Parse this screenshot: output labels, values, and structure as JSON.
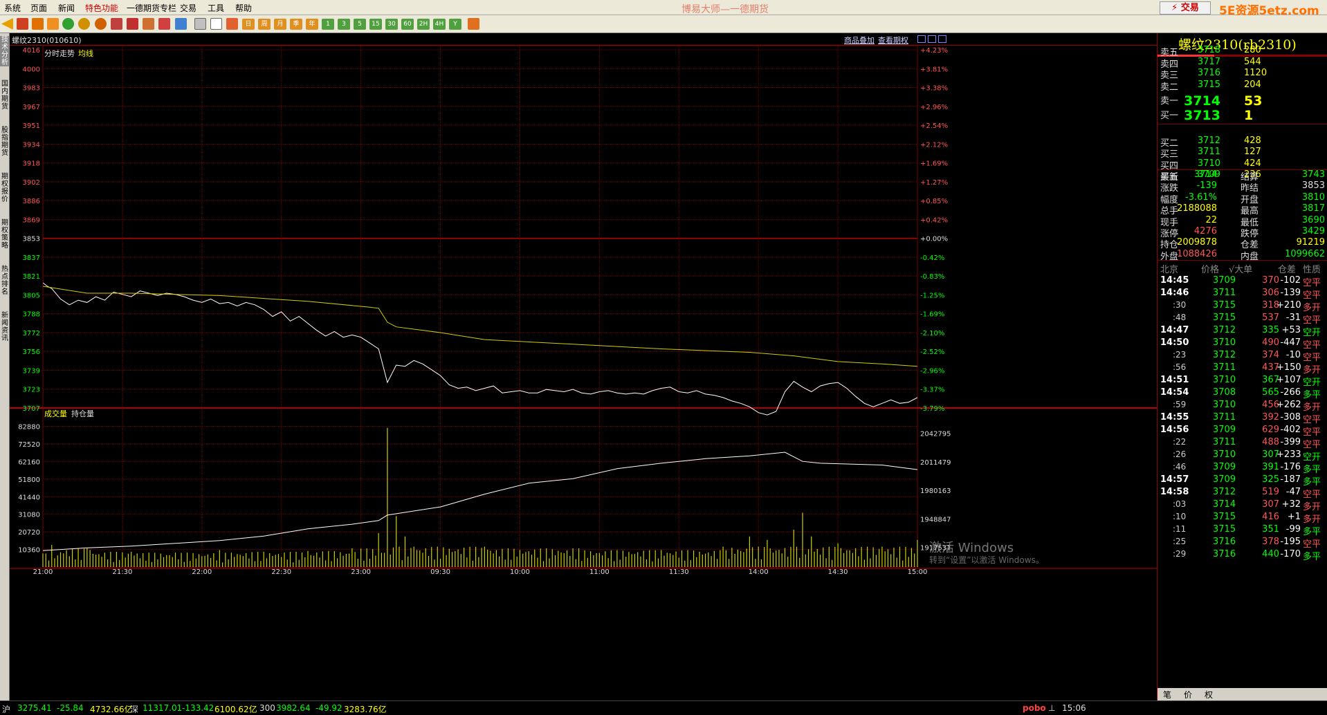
{
  "menu": {
    "items": [
      "系统",
      "页面",
      "新闻",
      "特色功能",
      "一德期货专栏",
      "交易",
      "工具",
      "帮助"
    ],
    "highlight_index": 3
  },
  "app_title": "博易大师—一德期货",
  "trade_button": "⚡ 交易",
  "brand": "5E资源5etz.com",
  "toolbar": {
    "period_labels": [
      "日",
      "周",
      "月",
      "季",
      "年",
      "1",
      "3",
      "5",
      "15",
      "30",
      "60",
      "2H",
      "4H",
      "Y"
    ]
  },
  "left_tabs": [
    "技术分析",
    "国内期货",
    "股指期货",
    "期权报价",
    "期权策略",
    "热点排名",
    "新闻资讯"
  ],
  "info": {
    "symbol_code": "螺纹2310(010610)",
    "link1": "商品叠加",
    "link2": "查看期权"
  },
  "chart_labels": {
    "price_title": "分时走势",
    "ma_label": "均线",
    "vol_title": "成交量",
    "oi_label": "持仓量"
  },
  "chart_data": {
    "type": "line",
    "price_ticks": [
      4016,
      4000,
      3983,
      3967,
      3951,
      3934,
      3918,
      3902,
      3886,
      3869,
      3853,
      3837,
      3821,
      3805,
      3788,
      3772,
      3756,
      3739,
      3723,
      3707
    ],
    "pct_ticks": [
      "+4.23%",
      "+3.81%",
      "+3.38%",
      "+2.96%",
      "+2.54%",
      "+2.12%",
      "+1.69%",
      "+1.27%",
      "+0.85%",
      "+0.42%",
      "+0.00%",
      "-0.42%",
      "-0.83%",
      "-1.25%",
      "-1.69%",
      "-2.10%",
      "-2.52%",
      "-2.96%",
      "-3.37%",
      "-3.79%"
    ],
    "reference_price": 3853,
    "ylim": [
      3707,
      4016
    ],
    "x_ticks": [
      "21:00",
      "21:30",
      "22:00",
      "22:30",
      "23:00",
      "09:30",
      "10:00",
      "11:00",
      "11:30",
      "14:00",
      "14:30",
      "15:00"
    ],
    "price_series": [
      [
        0,
        3815
      ],
      [
        0.5,
        3812
      ],
      [
        1,
        3810
      ],
      [
        2,
        3801
      ],
      [
        3,
        3796
      ],
      [
        4,
        3800
      ],
      [
        5,
        3798
      ],
      [
        6,
        3803
      ],
      [
        7,
        3800
      ],
      [
        8,
        3807
      ],
      [
        9,
        3805
      ],
      [
        10,
        3803
      ],
      [
        11,
        3808
      ],
      [
        12,
        3806
      ],
      [
        13,
        3804
      ],
      [
        14,
        3806
      ],
      [
        15,
        3805
      ],
      [
        16,
        3803
      ],
      [
        17,
        3800
      ],
      [
        18,
        3798
      ],
      [
        19,
        3801
      ],
      [
        20,
        3797
      ],
      [
        21,
        3798
      ],
      [
        22,
        3795
      ],
      [
        23,
        3798
      ],
      [
        24,
        3796
      ],
      [
        25,
        3792
      ],
      [
        26,
        3786
      ],
      [
        27,
        3790
      ],
      [
        28,
        3782
      ],
      [
        29,
        3786
      ],
      [
        30,
        3780
      ],
      [
        31,
        3774
      ],
      [
        32,
        3769
      ],
      [
        33,
        3773
      ],
      [
        34,
        3768
      ],
      [
        35,
        3770
      ],
      [
        36,
        3768
      ],
      [
        37,
        3763
      ],
      [
        38,
        3758
      ],
      [
        39,
        3729
      ],
      [
        40,
        3744
      ],
      [
        41,
        3743
      ],
      [
        42,
        3748
      ],
      [
        43,
        3745
      ],
      [
        44,
        3740
      ],
      [
        45,
        3735
      ],
      [
        46,
        3727
      ],
      [
        47,
        3724
      ],
      [
        48,
        3725
      ],
      [
        49,
        3722
      ],
      [
        50,
        3724
      ],
      [
        51,
        3726
      ],
      [
        52,
        3720
      ],
      [
        53,
        3721
      ],
      [
        54,
        3722
      ],
      [
        55,
        3720
      ],
      [
        56,
        3720
      ],
      [
        57,
        3723
      ],
      [
        58,
        3722
      ],
      [
        59,
        3721
      ],
      [
        60,
        3723
      ],
      [
        61,
        3720
      ],
      [
        62,
        3719
      ],
      [
        63,
        3721
      ],
      [
        64,
        3722
      ],
      [
        65,
        3720
      ],
      [
        66,
        3719
      ],
      [
        67,
        3720
      ],
      [
        68,
        3719
      ],
      [
        69,
        3722
      ],
      [
        70,
        3724
      ],
      [
        71,
        3725
      ],
      [
        72,
        3721
      ],
      [
        73,
        3720
      ],
      [
        74,
        3722
      ],
      [
        75,
        3719
      ],
      [
        76,
        3718
      ],
      [
        77,
        3716
      ],
      [
        78,
        3713
      ],
      [
        79,
        3711
      ],
      [
        80,
        3708
      ],
      [
        81,
        3703
      ],
      [
        82,
        3701
      ],
      [
        83,
        3704
      ],
      [
        84,
        3721
      ],
      [
        85,
        3730
      ],
      [
        86,
        3725
      ],
      [
        87,
        3721
      ],
      [
        88,
        3726
      ],
      [
        89,
        3728
      ],
      [
        90,
        3729
      ],
      [
        91,
        3724
      ],
      [
        92,
        3717
      ],
      [
        93,
        3711
      ],
      [
        94,
        3708
      ],
      [
        95,
        3711
      ],
      [
        96,
        3714
      ],
      [
        97,
        3711
      ],
      [
        98,
        3712
      ],
      [
        99,
        3716
      ]
    ],
    "avg_series": [
      [
        0,
        3812
      ],
      [
        5,
        3806
      ],
      [
        10,
        3806
      ],
      [
        20,
        3804
      ],
      [
        30,
        3799
      ],
      [
        37,
        3794
      ],
      [
        38,
        3793
      ],
      [
        39,
        3781
      ],
      [
        40,
        3777
      ],
      [
        45,
        3772
      ],
      [
        50,
        3766
      ],
      [
        60,
        3762
      ],
      [
        70,
        3758
      ],
      [
        80,
        3755
      ],
      [
        85,
        3752
      ],
      [
        90,
        3747
      ],
      [
        95,
        3745
      ],
      [
        99,
        3743
      ]
    ],
    "volume_ticks": [
      82880,
      72520,
      62160,
      51800,
      41440,
      31080,
      20720,
      10360
    ],
    "oi_ticks": [
      2042795,
      2011479,
      1980163,
      1948847,
      1917531
    ],
    "oi_ylim": [
      1896000,
      2060000
    ],
    "oi_series": [
      [
        0,
        1914000
      ],
      [
        5,
        1917000
      ],
      [
        10,
        1919000
      ],
      [
        20,
        1925000
      ],
      [
        25,
        1930000
      ],
      [
        30,
        1938000
      ],
      [
        35,
        1943000
      ],
      [
        38,
        1947000
      ],
      [
        39,
        1953000
      ],
      [
        45,
        1962000
      ],
      [
        50,
        1976000
      ],
      [
        55,
        1988000
      ],
      [
        60,
        1993000
      ],
      [
        65,
        2004000
      ],
      [
        70,
        2010000
      ],
      [
        75,
        2015000
      ],
      [
        80,
        2018000
      ],
      [
        84,
        2022000
      ],
      [
        86,
        2012000
      ],
      [
        88,
        2010000
      ],
      [
        95,
        2008000
      ],
      [
        99,
        2003000
      ]
    ],
    "volume_peaks": [
      [
        0,
        8000
      ],
      [
        1,
        13000
      ],
      [
        5,
        11000
      ],
      [
        10,
        9000
      ],
      [
        15,
        8500
      ],
      [
        20,
        10000
      ],
      [
        25,
        9000
      ],
      [
        30,
        9500
      ],
      [
        35,
        11000
      ],
      [
        38,
        20000
      ],
      [
        39,
        82000
      ],
      [
        40,
        30000
      ],
      [
        41,
        18000
      ],
      [
        42,
        12000
      ],
      [
        50,
        12000
      ],
      [
        60,
        11000
      ],
      [
        70,
        10000
      ],
      [
        77,
        12000
      ],
      [
        80,
        18000
      ],
      [
        82,
        16000
      ],
      [
        85,
        22000
      ],
      [
        86,
        32000
      ],
      [
        87,
        18000
      ],
      [
        90,
        14000
      ],
      [
        95,
        12000
      ],
      [
        99,
        16000
      ]
    ]
  },
  "quote": {
    "title": "螺纹2310(rb2310)",
    "asks": [
      {
        "label": "卖五",
        "price": "3718",
        "vol": "280"
      },
      {
        "label": "卖四",
        "price": "3717",
        "vol": "544"
      },
      {
        "label": "卖三",
        "price": "3716",
        "vol": "1120"
      },
      {
        "label": "卖二",
        "price": "3715",
        "vol": "204"
      },
      {
        "label": "卖一",
        "price": "3714",
        "vol": "53"
      }
    ],
    "bids": [
      {
        "label": "买一",
        "price": "3713",
        "vol": "1"
      },
      {
        "label": "买二",
        "price": "3712",
        "vol": "428"
      },
      {
        "label": "买三",
        "price": "3711",
        "vol": "127"
      },
      {
        "label": "买四",
        "price": "3710",
        "vol": "424"
      },
      {
        "label": "买五",
        "price": "3709",
        "vol": "236"
      }
    ],
    "stats": [
      {
        "l1": "最新",
        "v1": "3714",
        "c1": "g",
        "l2": "结算",
        "v2": "3743",
        "c2": "g"
      },
      {
        "l1": "涨跌",
        "v1": "-139",
        "c1": "g",
        "l2": "昨结",
        "v2": "3853",
        "c2": "w"
      },
      {
        "l1": "幅度",
        "v1": "-3.61%",
        "c1": "g",
        "l2": "开盘",
        "v2": "3810",
        "c2": "g"
      },
      {
        "l1": "总手",
        "v1": "2188088",
        "c1": "y",
        "l2": "最高",
        "v2": "3817",
        "c2": "g"
      },
      {
        "l1": "现手",
        "v1": "22",
        "c1": "y",
        "l2": "最低",
        "v2": "3690",
        "c2": "g"
      },
      {
        "l1": "涨停",
        "v1": "4276",
        "c1": "r",
        "l2": "跌停",
        "v2": "3429",
        "c2": "g"
      },
      {
        "l1": "持仓",
        "v1": "2009878",
        "c1": "y",
        "l2": "仓差",
        "v2": "91219",
        "c2": "y"
      },
      {
        "l1": "外盘",
        "v1": "1088426",
        "c1": "r",
        "l2": "内盘",
        "v2": "1099662",
        "c2": "g"
      }
    ],
    "tick_header": {
      "time": "北京",
      "price": "价格",
      "vol": "√大单",
      "chg": "仓差",
      "kind": "性质"
    },
    "ticks": [
      {
        "t": "14:45",
        "sub": false,
        "p": "3709",
        "v": "370",
        "c": "-102",
        "k": "空平",
        "kc": "r"
      },
      {
        "t": "14:46",
        "sub": false,
        "p": "3711",
        "v": "306",
        "c": "-139",
        "k": "空平",
        "kc": "r"
      },
      {
        "t": ":30",
        "sub": true,
        "p": "3715",
        "v": "318",
        "c": "+210",
        "k": "多开",
        "kc": "r"
      },
      {
        "t": ":48",
        "sub": true,
        "p": "3715",
        "v": "537",
        "c": "-31",
        "k": "空平",
        "kc": "r"
      },
      {
        "t": "14:47",
        "sub": false,
        "p": "3712",
        "v": "335",
        "c": "+53",
        "k": "空开",
        "kc": "g"
      },
      {
        "t": "14:50",
        "sub": false,
        "p": "3710",
        "v": "490",
        "c": "-447",
        "k": "空平",
        "kc": "r"
      },
      {
        "t": ":23",
        "sub": true,
        "p": "3712",
        "v": "374",
        "c": "-10",
        "k": "空平",
        "kc": "r"
      },
      {
        "t": ":56",
        "sub": true,
        "p": "3711",
        "v": "437",
        "c": "+150",
        "k": "多开",
        "kc": "r"
      },
      {
        "t": "14:51",
        "sub": false,
        "p": "3710",
        "v": "367",
        "c": "+107",
        "k": "空开",
        "kc": "g"
      },
      {
        "t": "14:54",
        "sub": false,
        "p": "3708",
        "v": "565",
        "c": "-266",
        "k": "多平",
        "kc": "g"
      },
      {
        "t": ":59",
        "sub": true,
        "p": "3710",
        "v": "456",
        "c": "+262",
        "k": "多开",
        "kc": "r"
      },
      {
        "t": "14:55",
        "sub": false,
        "p": "3711",
        "v": "392",
        "c": "-308",
        "k": "空平",
        "kc": "r"
      },
      {
        "t": "14:56",
        "sub": false,
        "p": "3709",
        "v": "629",
        "c": "-402",
        "k": "空平",
        "kc": "r"
      },
      {
        "t": ":22",
        "sub": true,
        "p": "3711",
        "v": "488",
        "c": "-399",
        "k": "空平",
        "kc": "r"
      },
      {
        "t": ":26",
        "sub": true,
        "p": "3710",
        "v": "307",
        "c": "+233",
        "k": "空开",
        "kc": "g"
      },
      {
        "t": ":46",
        "sub": true,
        "p": "3709",
        "v": "391",
        "c": "-176",
        "k": "多平",
        "kc": "g"
      },
      {
        "t": "14:57",
        "sub": false,
        "p": "3709",
        "v": "325",
        "c": "-187",
        "k": "多平",
        "kc": "g"
      },
      {
        "t": "14:58",
        "sub": false,
        "p": "3712",
        "v": "519",
        "c": "-47",
        "k": "空平",
        "kc": "r"
      },
      {
        "t": ":03",
        "sub": true,
        "p": "3714",
        "v": "307",
        "c": "+32",
        "k": "多开",
        "kc": "r"
      },
      {
        "t": ":10",
        "sub": true,
        "p": "3715",
        "v": "416",
        "c": "+1",
        "k": "多开",
        "kc": "r"
      },
      {
        "t": ":11",
        "sub": true,
        "p": "3715",
        "v": "351",
        "c": "-99",
        "k": "多平",
        "kc": "g"
      },
      {
        "t": ":25",
        "sub": true,
        "p": "3716",
        "v": "378",
        "c": "-195",
        "k": "空平",
        "kc": "r"
      },
      {
        "t": ":29",
        "sub": true,
        "p": "3716",
        "v": "440",
        "c": "-170",
        "k": "多平",
        "kc": "g"
      }
    ],
    "tabs": [
      "笔",
      "价",
      "权"
    ]
  },
  "status": [
    "沪",
    "3275.41",
    "-25.84",
    "4732.66亿",
    "深",
    "11317.01",
    "-133.42",
    "6100.62亿",
    "300",
    "3982.64",
    "-49.92",
    "3283.76亿",
    "pobo",
    "15:06"
  ],
  "watermark": {
    "line1": "激活 Windows",
    "line2": "转到“设置”以激活 Windows。"
  },
  "colors": {
    "up": "#ff5555",
    "down": "#00ff00",
    "grid": "#7a0000",
    "price_line": "#ffffff",
    "avg_line": "#d0d000",
    "volume": "#d0d000"
  }
}
